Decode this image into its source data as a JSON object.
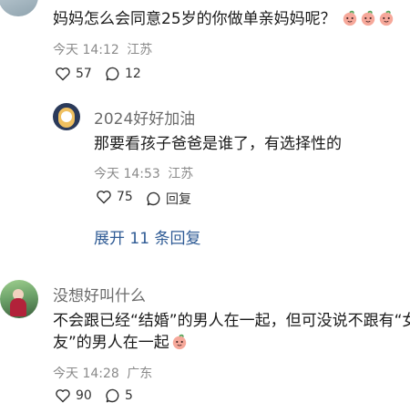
{
  "comment1": {
    "text": "妈妈怎么会同意25岁的你做单亲妈妈呢？",
    "emoji_icon": "peach-face-emoji",
    "emoji_count": 3,
    "time": "今天 14:12",
    "location": "江苏",
    "like_count": "57",
    "reply_count": "12",
    "reply": {
      "username": "2024好好加油",
      "text": "那要看孩子爸爸是谁了，有选择性的",
      "time": "今天 14:53",
      "location": "江苏",
      "like_count": "75",
      "reply_label": "回复"
    },
    "expand_label": "展开 11 条回复"
  },
  "comment2": {
    "username": "没想好叫什么",
    "text_line1": "不会跟已经“结婚”的男人在一起，但可没说不跟有“女",
    "text_line2": "友”的男人在一起",
    "emoji_icon": "peach-face-emoji",
    "time": "今天 14:28",
    "location": "广东",
    "like_count": "90",
    "reply_count": "5"
  },
  "colors": {
    "link": "#2f5b95",
    "meta": "#8a8a8a",
    "peach": "#f6a89a"
  }
}
